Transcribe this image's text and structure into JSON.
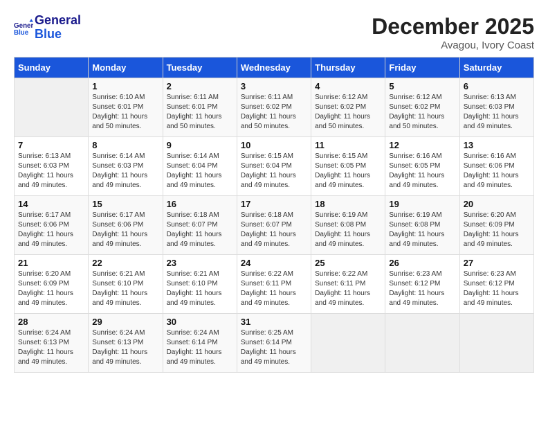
{
  "header": {
    "logo_line1": "General",
    "logo_line2": "Blue",
    "month": "December 2025",
    "location": "Avagou, Ivory Coast"
  },
  "days_of_week": [
    "Sunday",
    "Monday",
    "Tuesday",
    "Wednesday",
    "Thursday",
    "Friday",
    "Saturday"
  ],
  "weeks": [
    [
      {
        "day": "",
        "sunrise": "",
        "sunset": "",
        "daylight": ""
      },
      {
        "day": "1",
        "sunrise": "Sunrise: 6:10 AM",
        "sunset": "Sunset: 6:01 PM",
        "daylight": "Daylight: 11 hours and 50 minutes."
      },
      {
        "day": "2",
        "sunrise": "Sunrise: 6:11 AM",
        "sunset": "Sunset: 6:01 PM",
        "daylight": "Daylight: 11 hours and 50 minutes."
      },
      {
        "day": "3",
        "sunrise": "Sunrise: 6:11 AM",
        "sunset": "Sunset: 6:02 PM",
        "daylight": "Daylight: 11 hours and 50 minutes."
      },
      {
        "day": "4",
        "sunrise": "Sunrise: 6:12 AM",
        "sunset": "Sunset: 6:02 PM",
        "daylight": "Daylight: 11 hours and 50 minutes."
      },
      {
        "day": "5",
        "sunrise": "Sunrise: 6:12 AM",
        "sunset": "Sunset: 6:02 PM",
        "daylight": "Daylight: 11 hours and 50 minutes."
      },
      {
        "day": "6",
        "sunrise": "Sunrise: 6:13 AM",
        "sunset": "Sunset: 6:03 PM",
        "daylight": "Daylight: 11 hours and 49 minutes."
      }
    ],
    [
      {
        "day": "7",
        "sunrise": "Sunrise: 6:13 AM",
        "sunset": "Sunset: 6:03 PM",
        "daylight": "Daylight: 11 hours and 49 minutes."
      },
      {
        "day": "8",
        "sunrise": "Sunrise: 6:14 AM",
        "sunset": "Sunset: 6:03 PM",
        "daylight": "Daylight: 11 hours and 49 minutes."
      },
      {
        "day": "9",
        "sunrise": "Sunrise: 6:14 AM",
        "sunset": "Sunset: 6:04 PM",
        "daylight": "Daylight: 11 hours and 49 minutes."
      },
      {
        "day": "10",
        "sunrise": "Sunrise: 6:15 AM",
        "sunset": "Sunset: 6:04 PM",
        "daylight": "Daylight: 11 hours and 49 minutes."
      },
      {
        "day": "11",
        "sunrise": "Sunrise: 6:15 AM",
        "sunset": "Sunset: 6:05 PM",
        "daylight": "Daylight: 11 hours and 49 minutes."
      },
      {
        "day": "12",
        "sunrise": "Sunrise: 6:16 AM",
        "sunset": "Sunset: 6:05 PM",
        "daylight": "Daylight: 11 hours and 49 minutes."
      },
      {
        "day": "13",
        "sunrise": "Sunrise: 6:16 AM",
        "sunset": "Sunset: 6:06 PM",
        "daylight": "Daylight: 11 hours and 49 minutes."
      }
    ],
    [
      {
        "day": "14",
        "sunrise": "Sunrise: 6:17 AM",
        "sunset": "Sunset: 6:06 PM",
        "daylight": "Daylight: 11 hours and 49 minutes."
      },
      {
        "day": "15",
        "sunrise": "Sunrise: 6:17 AM",
        "sunset": "Sunset: 6:06 PM",
        "daylight": "Daylight: 11 hours and 49 minutes."
      },
      {
        "day": "16",
        "sunrise": "Sunrise: 6:18 AM",
        "sunset": "Sunset: 6:07 PM",
        "daylight": "Daylight: 11 hours and 49 minutes."
      },
      {
        "day": "17",
        "sunrise": "Sunrise: 6:18 AM",
        "sunset": "Sunset: 6:07 PM",
        "daylight": "Daylight: 11 hours and 49 minutes."
      },
      {
        "day": "18",
        "sunrise": "Sunrise: 6:19 AM",
        "sunset": "Sunset: 6:08 PM",
        "daylight": "Daylight: 11 hours and 49 minutes."
      },
      {
        "day": "19",
        "sunrise": "Sunrise: 6:19 AM",
        "sunset": "Sunset: 6:08 PM",
        "daylight": "Daylight: 11 hours and 49 minutes."
      },
      {
        "day": "20",
        "sunrise": "Sunrise: 6:20 AM",
        "sunset": "Sunset: 6:09 PM",
        "daylight": "Daylight: 11 hours and 49 minutes."
      }
    ],
    [
      {
        "day": "21",
        "sunrise": "Sunrise: 6:20 AM",
        "sunset": "Sunset: 6:09 PM",
        "daylight": "Daylight: 11 hours and 49 minutes."
      },
      {
        "day": "22",
        "sunrise": "Sunrise: 6:21 AM",
        "sunset": "Sunset: 6:10 PM",
        "daylight": "Daylight: 11 hours and 49 minutes."
      },
      {
        "day": "23",
        "sunrise": "Sunrise: 6:21 AM",
        "sunset": "Sunset: 6:10 PM",
        "daylight": "Daylight: 11 hours and 49 minutes."
      },
      {
        "day": "24",
        "sunrise": "Sunrise: 6:22 AM",
        "sunset": "Sunset: 6:11 PM",
        "daylight": "Daylight: 11 hours and 49 minutes."
      },
      {
        "day": "25",
        "sunrise": "Sunrise: 6:22 AM",
        "sunset": "Sunset: 6:11 PM",
        "daylight": "Daylight: 11 hours and 49 minutes."
      },
      {
        "day": "26",
        "sunrise": "Sunrise: 6:23 AM",
        "sunset": "Sunset: 6:12 PM",
        "daylight": "Daylight: 11 hours and 49 minutes."
      },
      {
        "day": "27",
        "sunrise": "Sunrise: 6:23 AM",
        "sunset": "Sunset: 6:12 PM",
        "daylight": "Daylight: 11 hours and 49 minutes."
      }
    ],
    [
      {
        "day": "28",
        "sunrise": "Sunrise: 6:24 AM",
        "sunset": "Sunset: 6:13 PM",
        "daylight": "Daylight: 11 hours and 49 minutes."
      },
      {
        "day": "29",
        "sunrise": "Sunrise: 6:24 AM",
        "sunset": "Sunset: 6:13 PM",
        "daylight": "Daylight: 11 hours and 49 minutes."
      },
      {
        "day": "30",
        "sunrise": "Sunrise: 6:24 AM",
        "sunset": "Sunset: 6:14 PM",
        "daylight": "Daylight: 11 hours and 49 minutes."
      },
      {
        "day": "31",
        "sunrise": "Sunrise: 6:25 AM",
        "sunset": "Sunset: 6:14 PM",
        "daylight": "Daylight: 11 hours and 49 minutes."
      },
      {
        "day": "",
        "sunrise": "",
        "sunset": "",
        "daylight": ""
      },
      {
        "day": "",
        "sunrise": "",
        "sunset": "",
        "daylight": ""
      },
      {
        "day": "",
        "sunrise": "",
        "sunset": "",
        "daylight": ""
      }
    ]
  ]
}
